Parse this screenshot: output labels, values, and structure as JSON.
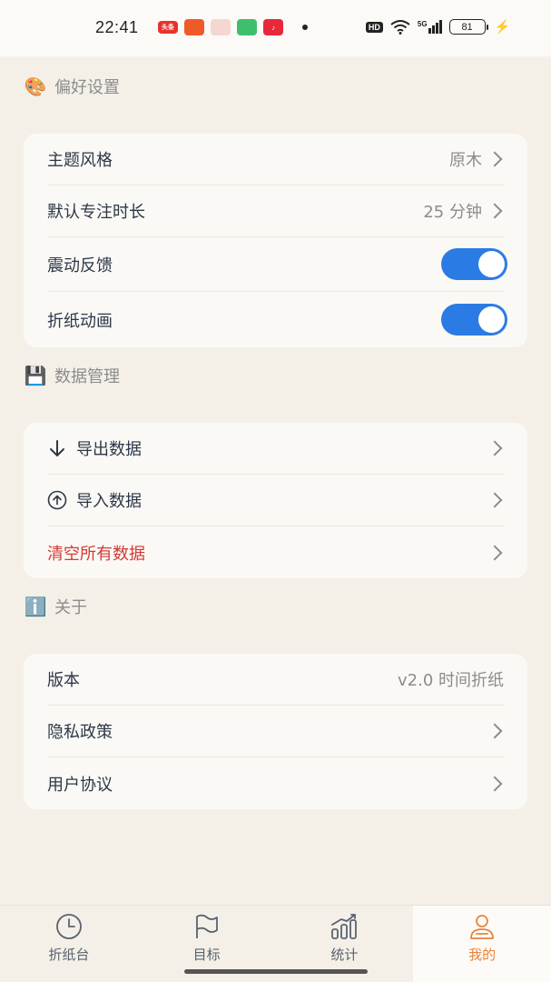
{
  "status_bar": {
    "time": "22:41",
    "notification_toutiao": "头条",
    "hd": "HD",
    "network": "5G",
    "battery": "81"
  },
  "sections": {
    "preferences": {
      "emoji": "🎨",
      "title": "偏好设置"
    },
    "data": {
      "emoji": "💾",
      "title": "数据管理"
    },
    "about": {
      "emoji": "ℹ️",
      "title": "关于"
    }
  },
  "preferences": {
    "theme_label": "主题风格",
    "theme_value": "原木",
    "duration_label": "默认专注时长",
    "duration_value": "25 分钟",
    "vibration_label": "震动反馈",
    "vibration_on": true,
    "fold_anim_label": "折纸动画",
    "fold_anim_on": true
  },
  "data_mgmt": {
    "export_label": "导出数据",
    "import_label": "导入数据",
    "clear_label": "清空所有数据"
  },
  "about": {
    "version_label": "版本",
    "version_value": "v2.0 时间折纸",
    "privacy_label": "隐私政策",
    "agreement_label": "用户协议"
  },
  "tabs": [
    {
      "label": "折纸台",
      "icon": "clock-icon"
    },
    {
      "label": "目标",
      "icon": "flag-icon"
    },
    {
      "label": "统计",
      "icon": "chart-icon"
    },
    {
      "label": "我的",
      "icon": "user-icon",
      "active": true
    }
  ],
  "colors": {
    "accent": "#2b7be4",
    "active_tab": "#e8843c",
    "danger": "#d23a35",
    "background": "#f4f0e8"
  }
}
